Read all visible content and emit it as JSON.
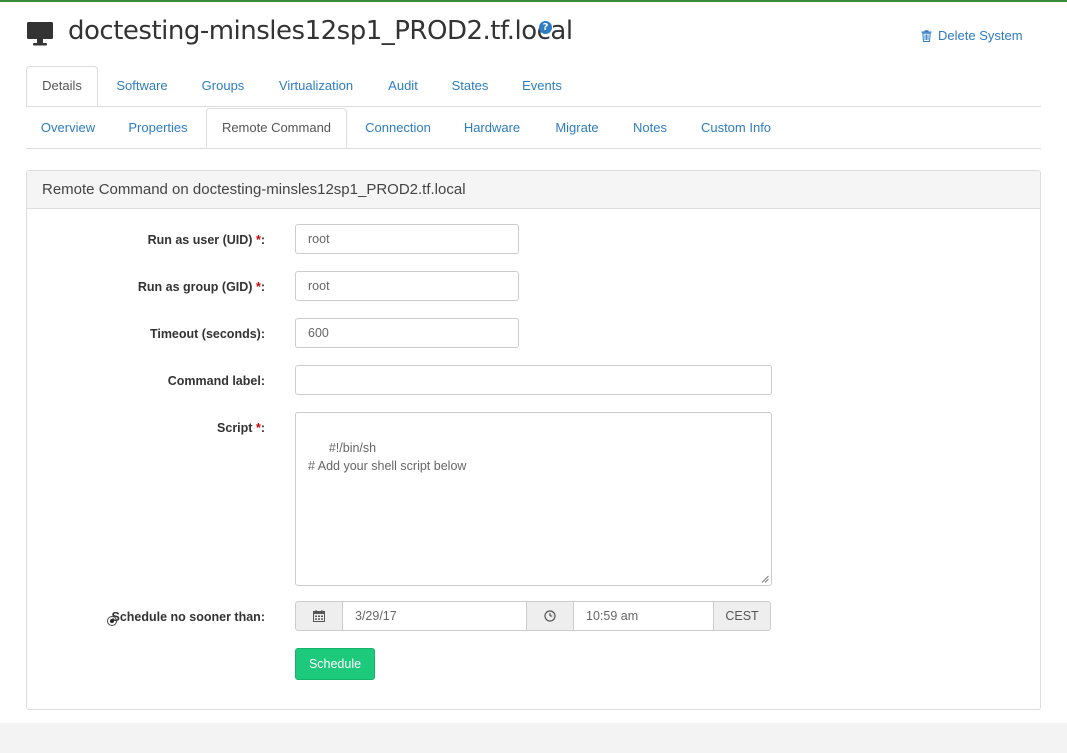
{
  "header": {
    "title": "doctesting-minsles12sp1_PROD2.tf.local",
    "help_icon": "question-circle-icon",
    "delete_label": "Delete System"
  },
  "tabs_primary": [
    "Details",
    "Software",
    "Groups",
    "Virtualization",
    "Audit",
    "States",
    "Events"
  ],
  "tabs_primary_active": "Details",
  "tabs_secondary": [
    "Overview",
    "Properties",
    "Remote Command",
    "Connection",
    "Hardware",
    "Migrate",
    "Notes",
    "Custom Info"
  ],
  "tabs_secondary_active": "Remote Command",
  "panel": {
    "title": "Remote Command on doctesting-minsles12sp1_PROD2.tf.local"
  },
  "form": {
    "uid_label": "Run as user (UID)",
    "uid_value": "root",
    "gid_label": "Run as group (GID)",
    "gid_value": "root",
    "timeout_label": "Timeout (seconds):",
    "timeout_value": "600",
    "command_label": "Command label:",
    "command_value": "",
    "script_label": "Script",
    "script_value": "#!/bin/sh\n# Add your shell script below",
    "schedule_label": "Schedule no sooner than:",
    "date_value": "3/29/17",
    "time_value": "10:59 am",
    "timezone": "CEST",
    "required_mark": "*",
    "colon": ":",
    "submit_label": "Schedule"
  },
  "colors": {
    "link": "#2e7cc2",
    "button": "#1dc97a",
    "required": "#cc0000"
  }
}
